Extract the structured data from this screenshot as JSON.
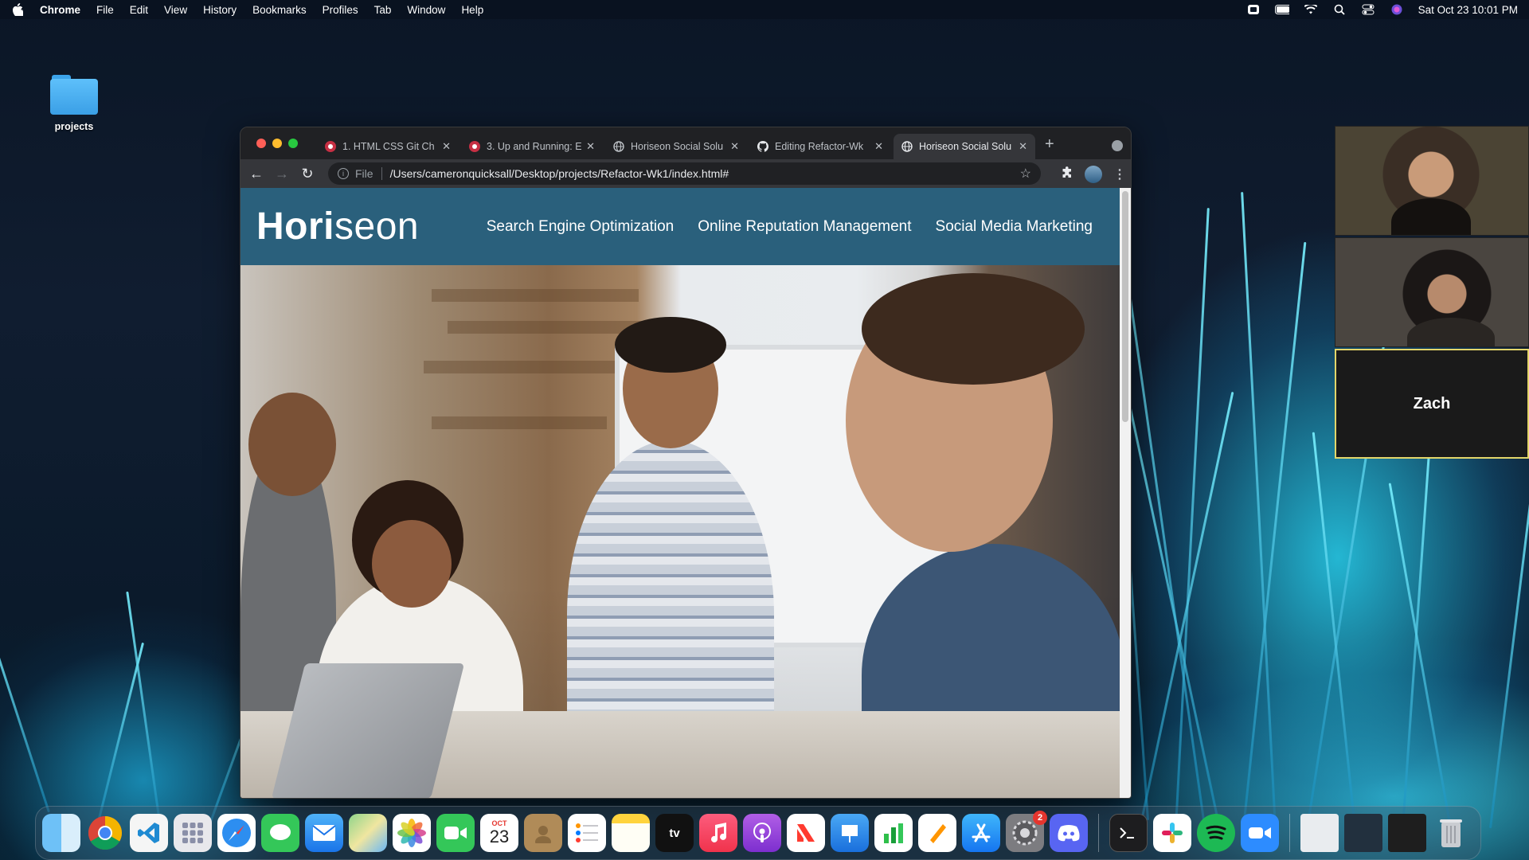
{
  "menubar": {
    "app_name": "Chrome",
    "items": [
      "File",
      "Edit",
      "View",
      "History",
      "Bookmarks",
      "Profiles",
      "Tab",
      "Window",
      "Help"
    ],
    "clock": "Sat Oct 23  10:01 PM"
  },
  "desktop": {
    "folder_label": "projects"
  },
  "browser": {
    "tabs": [
      {
        "title": "1. HTML CSS Git Ch",
        "favicon": "red-octo-icon"
      },
      {
        "title": "3. Up and Running: E",
        "favicon": "red-octo-icon"
      },
      {
        "title": "Horiseon Social Solu",
        "favicon": "globe-icon"
      },
      {
        "title": "Editing Refactor-Wk",
        "favicon": "github-icon"
      },
      {
        "title": "Horiseon Social Solu",
        "favicon": "globe-icon",
        "active": true
      }
    ],
    "address": {
      "scheme": "File",
      "url": "/Users/cameronquicksall/Desktop/projects/Refactor-Wk1/index.html#"
    }
  },
  "site": {
    "logo_bold": "Hori",
    "logo_light": "seon",
    "nav": [
      "Search Engine Optimization",
      "Online Reputation Management",
      "Social Media Marketing"
    ]
  },
  "zoom": {
    "participant_name": "Zach"
  },
  "dock": {
    "calendar_month": "OCT",
    "calendar_day": "23",
    "settings_badge": "2",
    "tv_label": "tv"
  },
  "colors": {
    "site_header": "#2a607c",
    "chrome_dark": "#202124",
    "chrome_toolbar": "#35363a"
  }
}
